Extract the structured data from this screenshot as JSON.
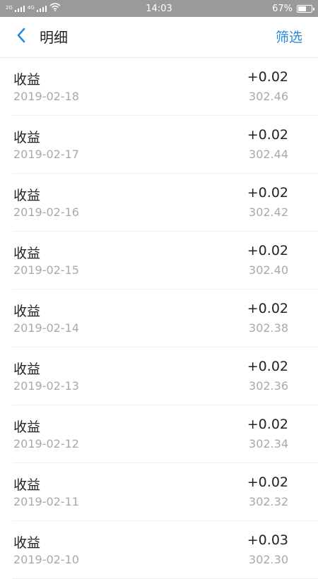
{
  "status_bar": {
    "sim1_label": "2G",
    "sim2_label": "4G",
    "time": "14:03",
    "battery_text": "67%",
    "battery_level": 0.67
  },
  "nav": {
    "back_icon": "chevron-left-icon",
    "title": "明细",
    "filter_label": "筛选"
  },
  "colors": {
    "accent": "#2a8ad8",
    "status_bar_bg": "#9a9a9a",
    "primary_text": "#222222",
    "secondary_text": "#a9a9a9"
  },
  "records": [
    {
      "title": "收益",
      "date": "2019-02-18",
      "amount": "+0.02",
      "balance": "302.46"
    },
    {
      "title": "收益",
      "date": "2019-02-17",
      "amount": "+0.02",
      "balance": "302.44"
    },
    {
      "title": "收益",
      "date": "2019-02-16",
      "amount": "+0.02",
      "balance": "302.42"
    },
    {
      "title": "收益",
      "date": "2019-02-15",
      "amount": "+0.02",
      "balance": "302.40"
    },
    {
      "title": "收益",
      "date": "2019-02-14",
      "amount": "+0.02",
      "balance": "302.38"
    },
    {
      "title": "收益",
      "date": "2019-02-13",
      "amount": "+0.02",
      "balance": "302.36"
    },
    {
      "title": "收益",
      "date": "2019-02-12",
      "amount": "+0.02",
      "balance": "302.34"
    },
    {
      "title": "收益",
      "date": "2019-02-11",
      "amount": "+0.02",
      "balance": "302.32"
    },
    {
      "title": "收益",
      "date": "2019-02-10",
      "amount": "+0.03",
      "balance": "302.30"
    }
  ]
}
